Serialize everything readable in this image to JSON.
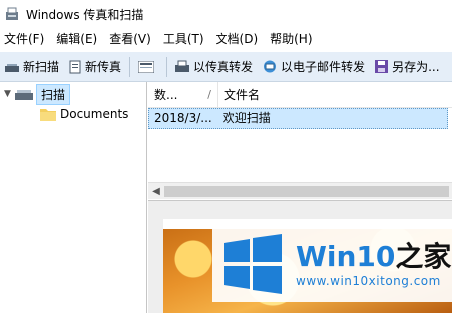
{
  "window": {
    "title": "Windows 传真和扫描"
  },
  "menu": [
    "文件(F)",
    "编辑(E)",
    "查看(V)",
    "工具(T)",
    "文档(D)",
    "帮助(H)"
  ],
  "toolbar": {
    "new_scan": "新扫描",
    "new_fax": "新传真",
    "forward_fax": "以传真转发",
    "forward_email": "以电子邮件转发",
    "save_as": "另存为..."
  },
  "tree": {
    "root": "扫描",
    "child": "Documents"
  },
  "list": {
    "columns": [
      "数...",
      "文件名"
    ],
    "sort_indicator": "/",
    "rows": [
      {
        "date": "2018/3/...",
        "name": "欢迎扫描"
      }
    ]
  },
  "watermark": {
    "brand_main": "Win10",
    "brand_accent": "之家",
    "url": "www.win10xitong.com"
  },
  "colors": {
    "toolbar_bg": "#e5eef8",
    "selection": "#cce8ff",
    "brand_blue": "#1e7fd6"
  }
}
